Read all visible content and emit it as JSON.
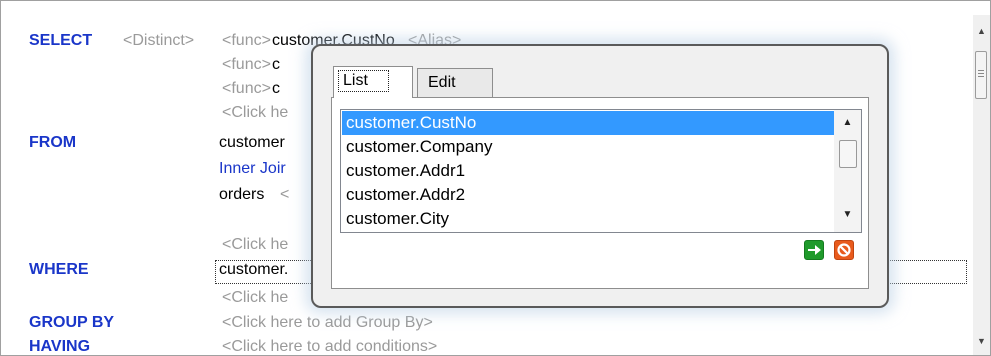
{
  "query": {
    "select_keyword": "SELECT",
    "distinct_placeholder": "<Distinct>",
    "func_placeholder": "<func>",
    "select_field_1": "customer.CustNo",
    "alias_placeholder": "<Alias>",
    "select_row2_field_partial": "c",
    "select_row3_field_partial": "c",
    "click_here_partial": "<Click he",
    "from_keyword": "FROM",
    "from_table_1": "customer",
    "join_text_partial": "Inner Joir",
    "from_table_2": "orders",
    "from_table_2_suffix": "<",
    "where_keyword": "WHERE",
    "where_field_partial": "customer.",
    "group_by_keyword": "GROUP BY",
    "group_by_placeholder": "<Click here to add Group By>",
    "having_keyword": "HAVING",
    "having_placeholder": "<Click here to add conditions>"
  },
  "popup": {
    "tabs": [
      {
        "label": "List",
        "selected": true
      },
      {
        "label": "Edit",
        "selected": false
      }
    ],
    "list_items": [
      "customer.CustNo",
      "customer.Company",
      "customer.Addr1",
      "customer.Addr2",
      "customer.City"
    ],
    "selected_index": 0,
    "ok_icon": "green-arrow-right-icon",
    "cancel_icon": "red-no-sign-icon"
  },
  "colors": {
    "keyword": "#1a36c9",
    "placeholder": "#9a9a9a",
    "selection": "#3399ff",
    "ok_button": "#1f9a2b",
    "cancel_button": "#e85a1c"
  }
}
